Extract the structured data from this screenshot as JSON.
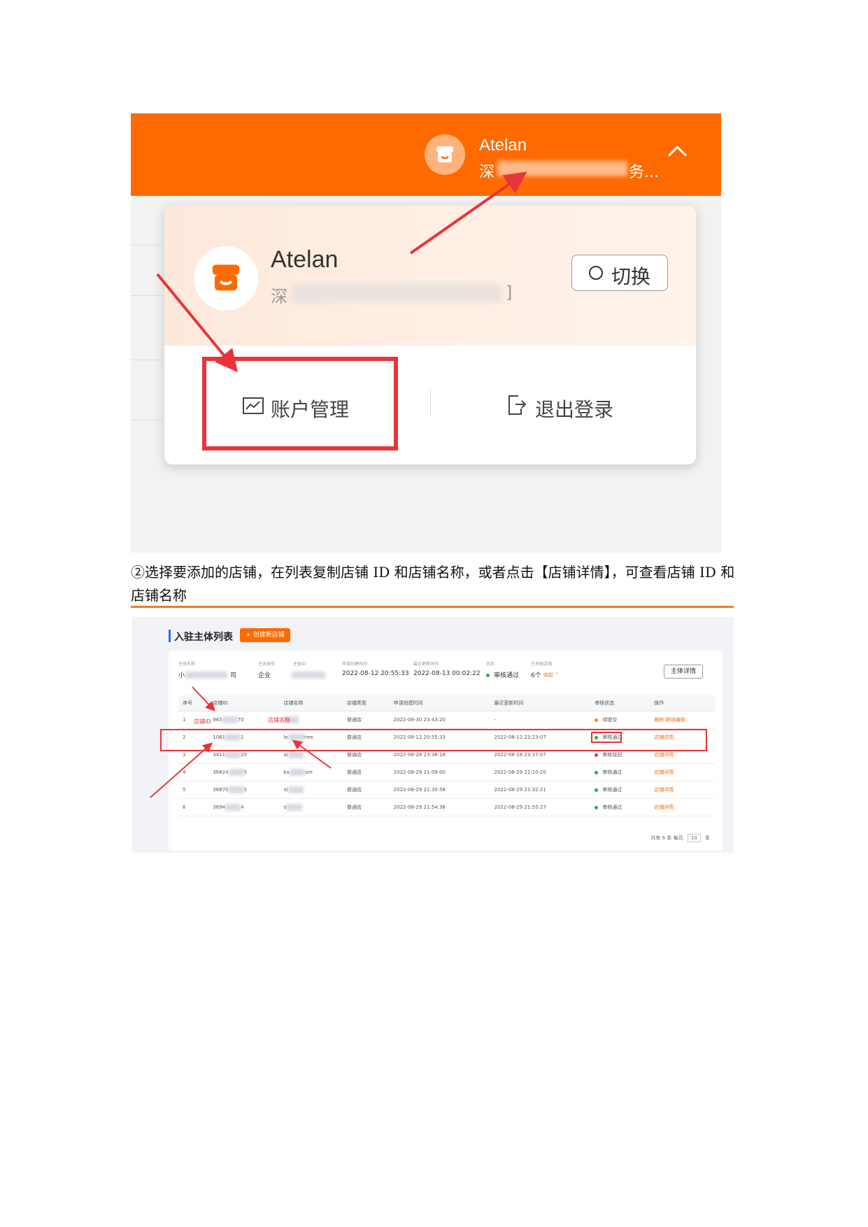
{
  "figure1": {
    "header": {
      "account_name": "Atelan",
      "company_prefix": "深",
      "company_suffix": "务..."
    },
    "dropdown": {
      "account_name": "Atelan",
      "company_prefix": "深",
      "company_suffix": "]",
      "switch_label": "切换",
      "account_manage_label": "账户管理",
      "logout_label": "退出登录"
    }
  },
  "caption": "②选择要添加的店铺，在列表复制店铺 ID 和店铺名称，或者点击【店铺详情】，可查看店铺 ID 和店铺名称",
  "figure2": {
    "title": "入驻主体列表",
    "create_button": "+ 创建新店铺",
    "entity": {
      "name_label": "主体名称",
      "name_prefix": "小",
      "name_suffix": "司",
      "type_label": "主体类型",
      "type_value": "企业",
      "id_label": "主体ID",
      "created_label": "申请创建时间",
      "created_value": "2022-08-12 20:55:33",
      "updated_label": "最近更新时间",
      "updated_value": "2022-08-13 00:02:22",
      "status_label": "状态",
      "status_value": "审核通过",
      "shops_label": "已关联店铺",
      "shops_value": "6个",
      "collapse_label": "收起 ^",
      "detail_button": "主体详情"
    },
    "table": {
      "headers": [
        "序号",
        "店铺ID",
        "店铺名称",
        "店铺类型",
        "申请创建时间",
        "最近更新时间",
        "审核状态",
        "操作"
      ],
      "rows": [
        {
          "no": "1",
          "id_a": "",
          "id_b": "965",
          "id_c": "70",
          "name_a": "",
          "name_b": "",
          "type": "普通店",
          "created": "2022-08-30 23:43:20",
          "updated": "-",
          "status": "待提交",
          "status_color": "#ff8a00",
          "op": "删除  继续编辑"
        },
        {
          "no": "2",
          "id_a": "1061",
          "id_b": "",
          "id_c": "1",
          "name_a": "le",
          "name_b": "tree",
          "type": "普通店",
          "created": "2022-08-12 20:55:33",
          "updated": "2022-08-12 23:23:07",
          "status": "审核通过",
          "status_color": "#19b34a",
          "op": "店铺详情"
        },
        {
          "no": "3",
          "id_a": "3411",
          "id_b": "",
          "id_c": "25",
          "name_a": "al",
          "name_b": "",
          "type": "普通店",
          "created": "2022-08-28 23:36:18",
          "updated": "2022-08-28 23:37:07",
          "status": "审核驳回",
          "status_color": "#e8343a",
          "op": "店铺详情"
        },
        {
          "no": "4",
          "id_a": "36824",
          "id_b": "",
          "id_c": "5",
          "name_a": "ka",
          "name_b": "am",
          "type": "普通店",
          "created": "2022-08-29 21:09:00",
          "updated": "2022-08-29 21:10:20",
          "status": "审核通过",
          "status_color": "#19b34a",
          "op": "店铺详情"
        },
        {
          "no": "5",
          "id_a": "36870",
          "id_b": "",
          "id_c": "5",
          "name_a": "st",
          "name_b": "",
          "type": "普通店",
          "created": "2022-08-29 21:30:58",
          "updated": "2022-08-29 21:32:21",
          "status": "审核通过",
          "status_color": "#19b34a",
          "op": "店铺详情"
        },
        {
          "no": "6",
          "id_a": "3694",
          "id_b": "",
          "id_c": "4",
          "name_a": "d",
          "name_b": "",
          "type": "普通店",
          "created": "2022-08-29 21:54:36",
          "updated": "2022-08-29 21:55:27",
          "status": "审核通过",
          "status_color": "#19b34a",
          "op": "店铺详情"
        }
      ]
    },
    "annotations": {
      "shop_id": "店铺ID",
      "shop_name": "店铺名称"
    },
    "pager": {
      "total": "共有 6 条",
      "per_page_label": "每页",
      "per_page_value": "10",
      "unit": "条"
    }
  },
  "colors": {
    "brand_orange": "#ff6a00",
    "highlight_red": "#e8343a",
    "divider_orange": "#f07a2a"
  }
}
